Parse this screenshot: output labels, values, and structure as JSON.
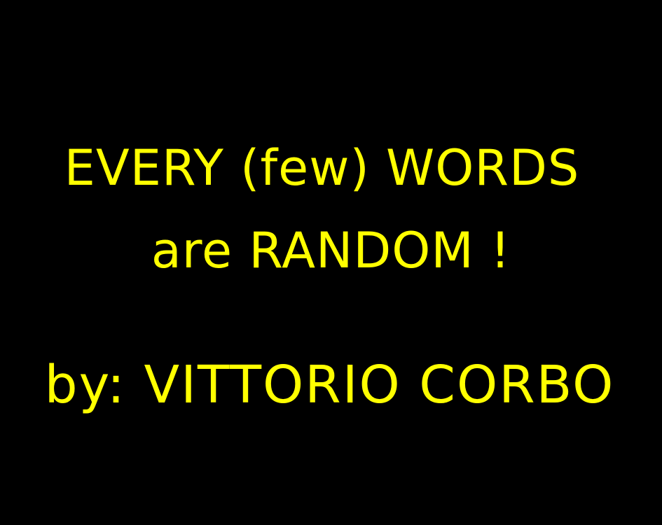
{
  "slide": {
    "background_color": "#000000",
    "text_color": "#FFFF00",
    "title_line_1": "EVERY (few) WORDS",
    "title_line_2": "are RANDOM !",
    "author_line": "by: VITTORIO CORBO"
  }
}
